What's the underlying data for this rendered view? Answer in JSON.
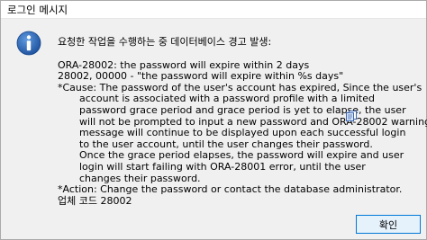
{
  "window": {
    "title": "로그인 메시지"
  },
  "icons": {
    "info": "info-icon",
    "copy": "copy-icon"
  },
  "message": {
    "heading": "요청한 작업을 수행하는 중 데이터베이스 경고 발생:",
    "lines": [
      "ORA-28002: the password will expire within 2 days",
      "28002, 00000 -  \"the password will expire within %s days\"",
      "*Cause:      The password of the user's account has expired, Since the user's",
      "account is associated with a password profile with a limited",
      "password grace period and grace period is yet to elapse, the user",
      "will not be prompted to input a new password and ORA-28002 warning",
      "message will continue to be displayed upon each successful login",
      "to the user account, until the user changes their password.",
      "Once the grace period elapses, the password will expire and user",
      "login will start failing with ORA-28001 error, until the user",
      "changes their password.",
      "*Action:   Change the password or contact the database administrator.",
      "업체 코드 28002"
    ]
  },
  "buttons": {
    "ok_label": "확인"
  },
  "colors": {
    "info_icon_fill": "#1c5fb3",
    "button_border": "#0078d7",
    "button_fill": "#e5f1fb"
  }
}
